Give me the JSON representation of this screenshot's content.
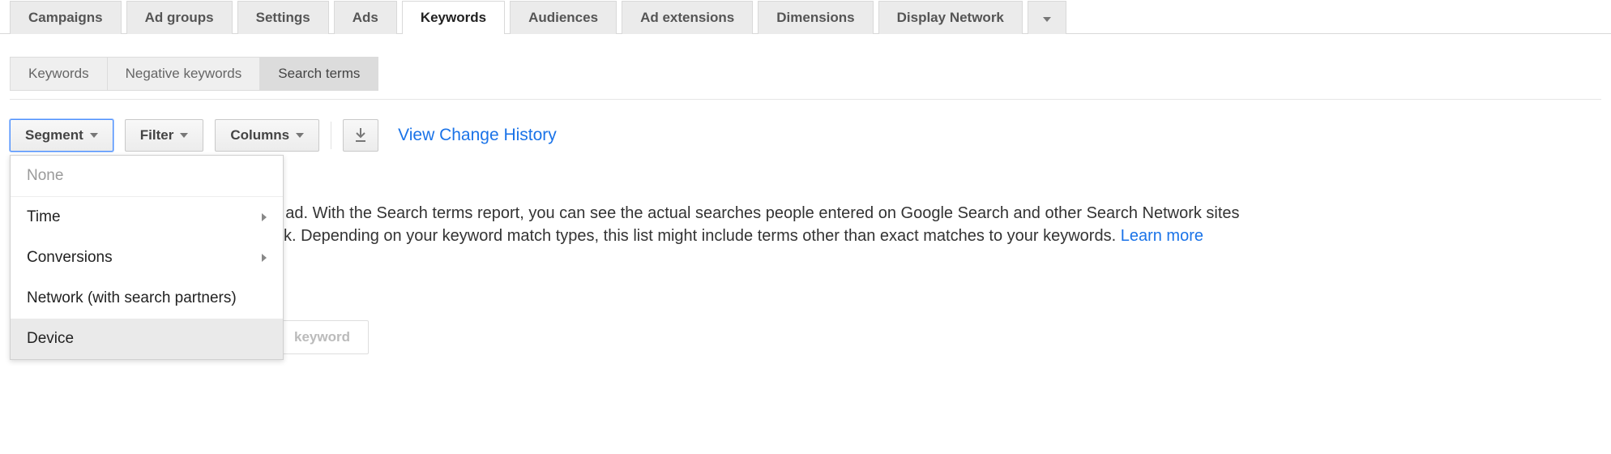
{
  "mainTabs": [
    "Campaigns",
    "Ad groups",
    "Settings",
    "Ads",
    "Keywords",
    "Audiences",
    "Ad extensions",
    "Dimensions",
    "Display Network"
  ],
  "mainTabActiveIndex": 4,
  "subTabs": [
    "Keywords",
    "Negative keywords",
    "Search terms"
  ],
  "subTabActiveIndex": 2,
  "toolbar": {
    "segment": "Segment",
    "filter": "Filter",
    "columns": "Columns",
    "viewHistory": "View Change History"
  },
  "segmentMenu": {
    "none": "None",
    "time": "Time",
    "conversions": "Conversions",
    "network": "Network (with search partners)",
    "device": "Device",
    "hoverIndex": 4
  },
  "body": {
    "fragment1": "r ad. With the Search terms report, you can see the actual searches people entered on Google Search and other Search Network sites",
    "fragment2": "ck. Depending on your keyword match types, this list might include terms other than exact matches to your keywords. ",
    "learnMore": "Learn more"
  },
  "ghostButton": "keyword"
}
